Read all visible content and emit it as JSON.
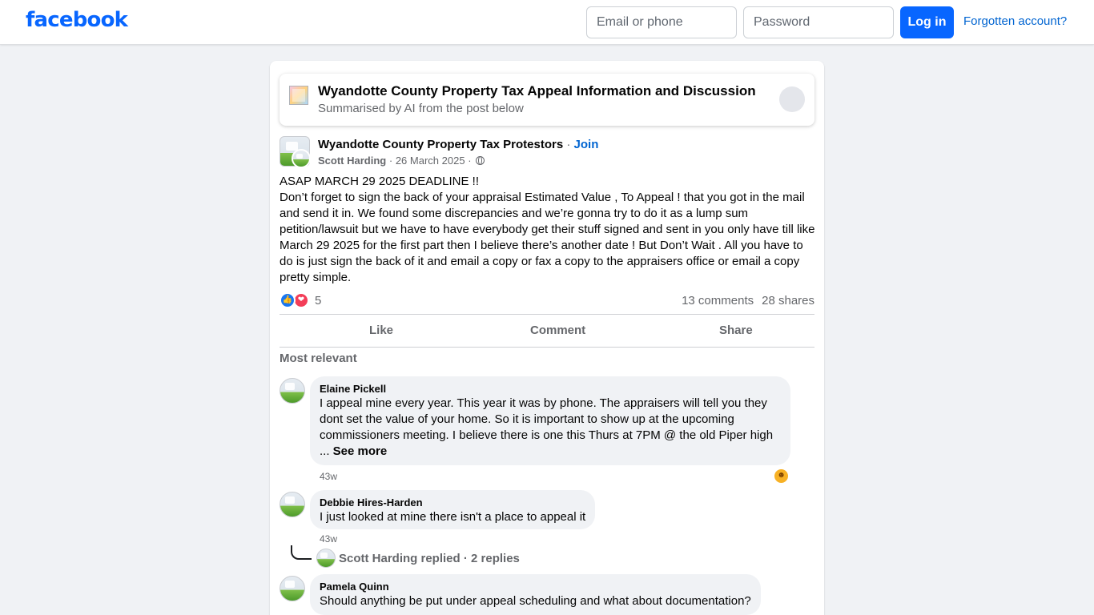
{
  "header": {
    "logo": "facebook",
    "email_placeholder": "Email or phone",
    "password_placeholder": "Password",
    "login_label": "Log in",
    "forgot_label": "Forgotten account?"
  },
  "ai_summary": {
    "title": "Wyandotte County Property Tax Appeal Information and Discussion",
    "subtitle": "Summarised by AI from the post below"
  },
  "post": {
    "group_name": "Wyandotte County Property Tax Protestors",
    "separator": "·",
    "join_label": "Join",
    "author": "Scott Harding",
    "date": "26 March 2025",
    "text_line1": "ASAP MARCH 29 2025 DEADLINE  !!",
    "text_body": "Don’t forget to sign the back of your appraisal Estimated Value  , To Appeal  ! that you got in the mail and send it in. We found some discrepancies and we’re gonna try to do it as a lump sum petition/lawsuit but we have to have everybody get their stuff signed and sent in you only have till like March 29 2025 for the first part then I believe there’s another date ! But Don’t Wait . All you have to do is just sign the back of it and email a copy or fax a copy to the appraisers office or email a copy pretty simple.",
    "reaction_count": "5",
    "comments_count": "13 comments",
    "shares_count": "28 shares"
  },
  "actions": {
    "like": "Like",
    "comment": "Comment",
    "share": "Share"
  },
  "comments_filter": "Most relevant",
  "comments": [
    {
      "name": "Elaine Pickell",
      "text": "I appeal mine every year. This year it was by phone. The appraisers will tell you they dont set the value of your home. So it is important to show up at the upcoming commissioners meeting. I believe there is one this Thurs at 7PM @ the old Piper high",
      "ellipsis": "... ",
      "see_more": "See more",
      "time": "43w"
    },
    {
      "name": "Debbie Hires-Harden",
      "text": "I just looked at mine there isn't a place to appeal it",
      "time": "43w",
      "replies": "Scott Harding replied · 2 replies"
    },
    {
      "name": "Pamela Quinn",
      "text": "Should anything be put under appeal scheduling and what about documentation?"
    }
  ],
  "icons": {
    "like_reaction": "thumbs-up-icon",
    "love_reaction": "heart-icon",
    "privacy": "globe-icon",
    "comment_reaction": "haha-emoji-icon"
  },
  "colors": {
    "brand": "#0866ff",
    "link": "#0064d1",
    "background": "#f0f2f5"
  }
}
